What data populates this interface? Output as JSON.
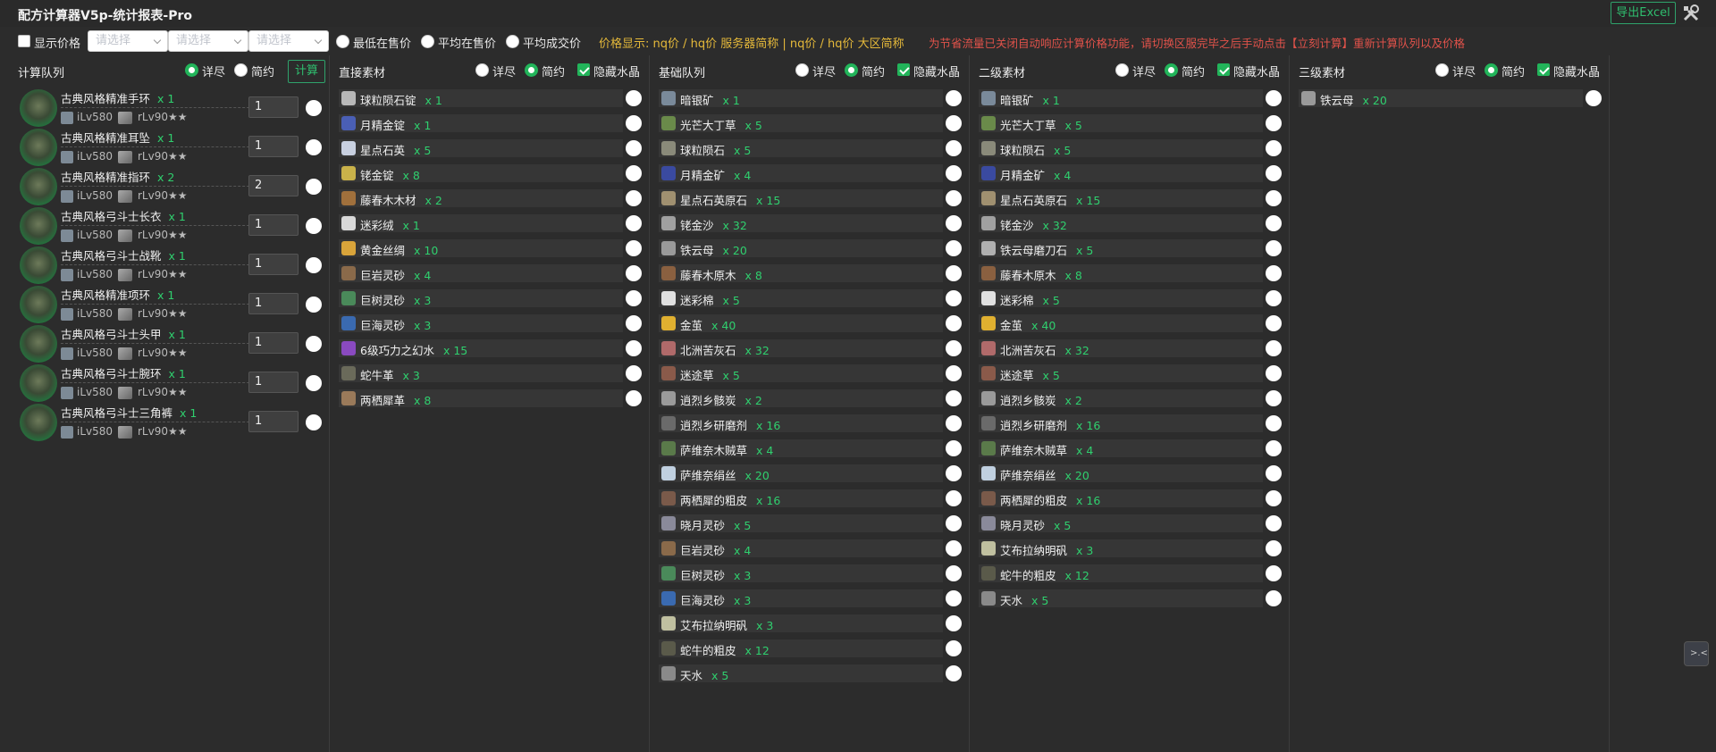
{
  "app": {
    "title": "配方计算器V5p-统计报表-Pro",
    "export_label": "导出Excel"
  },
  "options": {
    "show_price_label": "显示价格",
    "selects": [
      {
        "placeholder": "请选择"
      },
      {
        "placeholder": "请选择"
      },
      {
        "placeholder": "请选择"
      }
    ],
    "price_modes": [
      "最低在售价",
      "平均在售价",
      "平均成交价"
    ],
    "price_display": "价格显示:   nq价 / hq价 服务器简称 | nq价 / hq价 大区简称",
    "notice": "为节省流量已关闭自动响应计算价格功能，请切换区服完毕之后手动点击【立刻计算】重新计算队列以及价格"
  },
  "view_modes": {
    "detail": "详尽",
    "brief": "简约",
    "hide_crystal": "隐藏水晶"
  },
  "queue": {
    "title": "计算队列",
    "calc_label": "计算",
    "items": [
      {
        "name": "古典风格精准手环",
        "count": "x 1",
        "ilv": "iLv580",
        "rlv": "rLv90★★",
        "qty": "1"
      },
      {
        "name": "古典风格精准耳坠",
        "count": "x 1",
        "ilv": "iLv580",
        "rlv": "rLv90★★",
        "qty": "1"
      },
      {
        "name": "古典风格精准指环",
        "count": "x 2",
        "ilv": "iLv580",
        "rlv": "rLv90★★",
        "qty": "2"
      },
      {
        "name": "古典风格弓斗士长衣",
        "count": "x 1",
        "ilv": "iLv580",
        "rlv": "rLv90★★",
        "qty": "1"
      },
      {
        "name": "古典风格弓斗士战靴",
        "count": "x 1",
        "ilv": "iLv580",
        "rlv": "rLv90★★",
        "qty": "1"
      },
      {
        "name": "古典风格精准项环",
        "count": "x 1",
        "ilv": "iLv580",
        "rlv": "rLv90★★",
        "qty": "1"
      },
      {
        "name": "古典风格弓斗士头甲",
        "count": "x 1",
        "ilv": "iLv580",
        "rlv": "rLv90★★",
        "qty": "1"
      },
      {
        "name": "古典风格弓斗士腕环",
        "count": "x 1",
        "ilv": "iLv580",
        "rlv": "rLv90★★",
        "qty": "1"
      },
      {
        "name": "古典风格弓斗士三角裤",
        "count": "x 1",
        "ilv": "iLv580",
        "rlv": "rLv90★★",
        "qty": "1"
      }
    ]
  },
  "columns": [
    {
      "title": "直接素材",
      "items": [
        {
          "name": "球粒陨石锭",
          "qty": "x 1",
          "color": "#b8b8b8"
        },
        {
          "name": "月精金锭",
          "qty": "x 1",
          "color": "#4a5fb5"
        },
        {
          "name": "星点石英",
          "qty": "x 5",
          "color": "#c8d0e0"
        },
        {
          "name": "铑金锭",
          "qty": "x 8",
          "color": "#c9b24a"
        },
        {
          "name": "藤春木木材",
          "qty": "x 2",
          "color": "#a0703c"
        },
        {
          "name": "迷彩绒",
          "qty": "x 1",
          "color": "#d8d8d8"
        },
        {
          "name": "黄金丝绸",
          "qty": "x 10",
          "color": "#d9a43a"
        },
        {
          "name": "巨岩灵砂",
          "qty": "x 4",
          "color": "#8a6a4a"
        },
        {
          "name": "巨树灵砂",
          "qty": "x 3",
          "color": "#4a8a5a"
        },
        {
          "name": "巨海灵砂",
          "qty": "x 3",
          "color": "#3a6ab0"
        },
        {
          "name": "6级巧力之幻水",
          "qty": "x 15",
          "color": "#8a4ac0"
        },
        {
          "name": "蛇牛革",
          "qty": "x 3",
          "color": "#6a6a5a"
        },
        {
          "name": "两栖犀革",
          "qty": "x 8",
          "color": "#9a7a5a"
        }
      ]
    },
    {
      "title": "基础队列",
      "items": [
        {
          "name": "暗银矿",
          "qty": "x 1",
          "color": "#7a8a9a"
        },
        {
          "name": "光芒大丁草",
          "qty": "x 5",
          "color": "#6a8a4a"
        },
        {
          "name": "球粒陨石",
          "qty": "x 5",
          "color": "#8a8a7a"
        },
        {
          "name": "月精金矿",
          "qty": "x 4",
          "color": "#3a4aa0"
        },
        {
          "name": "星点石英原石",
          "qty": "x 15",
          "color": "#a09070"
        },
        {
          "name": "铑金沙",
          "qty": "x 32",
          "color": "#a0a0a0"
        },
        {
          "name": "铁云母",
          "qty": "x 20",
          "color": "#9a9a9a"
        },
        {
          "name": "藤春木原木",
          "qty": "x 8",
          "color": "#8a6040"
        },
        {
          "name": "迷彩棉",
          "qty": "x 5",
          "color": "#e0e0e0"
        },
        {
          "name": "金茧",
          "qty": "x 40",
          "color": "#e0b030"
        },
        {
          "name": "北洲苦灰石",
          "qty": "x 32",
          "color": "#b06a6a"
        },
        {
          "name": "迷途草",
          "qty": "x 5",
          "color": "#8a5a4a"
        },
        {
          "name": "逍烈乡骸炭",
          "qty": "x 2",
          "color": "#9a9a9a"
        },
        {
          "name": "逍烈乡研磨剂",
          "qty": "x 16",
          "color": "#6a6a6a"
        },
        {
          "name": "萨维奈木贼草",
          "qty": "x 4",
          "color": "#5a7a4a"
        },
        {
          "name": "萨维奈绢丝",
          "qty": "x 20",
          "color": "#c0d0e0"
        },
        {
          "name": "两栖犀的粗皮",
          "qty": "x 16",
          "color": "#7a5a4a"
        },
        {
          "name": "晓月灵砂",
          "qty": "x 5",
          "color": "#8a8a9a"
        },
        {
          "name": "巨岩灵砂",
          "qty": "x 4",
          "color": "#8a6a4a"
        },
        {
          "name": "巨树灵砂",
          "qty": "x 3",
          "color": "#4a8a5a"
        },
        {
          "name": "巨海灵砂",
          "qty": "x 3",
          "color": "#3a6ab0"
        },
        {
          "name": "艾布拉纳明矾",
          "qty": "x 3",
          "color": "#c0c0a0"
        },
        {
          "name": "蛇牛的粗皮",
          "qty": "x 12",
          "color": "#5a5a4a"
        },
        {
          "name": "天水",
          "qty": "x 5",
          "color": "#8a8a8a"
        }
      ]
    },
    {
      "title": "二级素材",
      "items": [
        {
          "name": "暗银矿",
          "qty": "x 1",
          "color": "#7a8a9a"
        },
        {
          "name": "光芒大丁草",
          "qty": "x 5",
          "color": "#6a8a4a"
        },
        {
          "name": "球粒陨石",
          "qty": "x 5",
          "color": "#8a8a7a"
        },
        {
          "name": "月精金矿",
          "qty": "x 4",
          "color": "#3a4aa0"
        },
        {
          "name": "星点石英原石",
          "qty": "x 15",
          "color": "#a09070"
        },
        {
          "name": "铑金沙",
          "qty": "x 32",
          "color": "#a0a0a0"
        },
        {
          "name": "铁云母磨刀石",
          "qty": "x 5",
          "color": "#b0b0b0"
        },
        {
          "name": "藤春木原木",
          "qty": "x 8",
          "color": "#8a6040"
        },
        {
          "name": "迷彩棉",
          "qty": "x 5",
          "color": "#e0e0e0"
        },
        {
          "name": "金茧",
          "qty": "x 40",
          "color": "#e0b030"
        },
        {
          "name": "北洲苦灰石",
          "qty": "x 32",
          "color": "#b06a6a"
        },
        {
          "name": "迷途草",
          "qty": "x 5",
          "color": "#8a5a4a"
        },
        {
          "name": "逍烈乡骸炭",
          "qty": "x 2",
          "color": "#9a9a9a"
        },
        {
          "name": "逍烈乡研磨剂",
          "qty": "x 16",
          "color": "#6a6a6a"
        },
        {
          "name": "萨维奈木贼草",
          "qty": "x 4",
          "color": "#5a7a4a"
        },
        {
          "name": "萨维奈绢丝",
          "qty": "x 20",
          "color": "#c0d0e0"
        },
        {
          "name": "两栖犀的粗皮",
          "qty": "x 16",
          "color": "#7a5a4a"
        },
        {
          "name": "晓月灵砂",
          "qty": "x 5",
          "color": "#8a8a9a"
        },
        {
          "name": "艾布拉纳明矾",
          "qty": "x 3",
          "color": "#c0c0a0"
        },
        {
          "name": "蛇牛的粗皮",
          "qty": "x 12",
          "color": "#5a5a4a"
        },
        {
          "name": "天水",
          "qty": "x 5",
          "color": "#8a8a8a"
        }
      ]
    },
    {
      "title": "三级素材",
      "items": [
        {
          "name": "铁云母",
          "qty": "x 20",
          "color": "#9a9a9a"
        }
      ]
    }
  ]
}
